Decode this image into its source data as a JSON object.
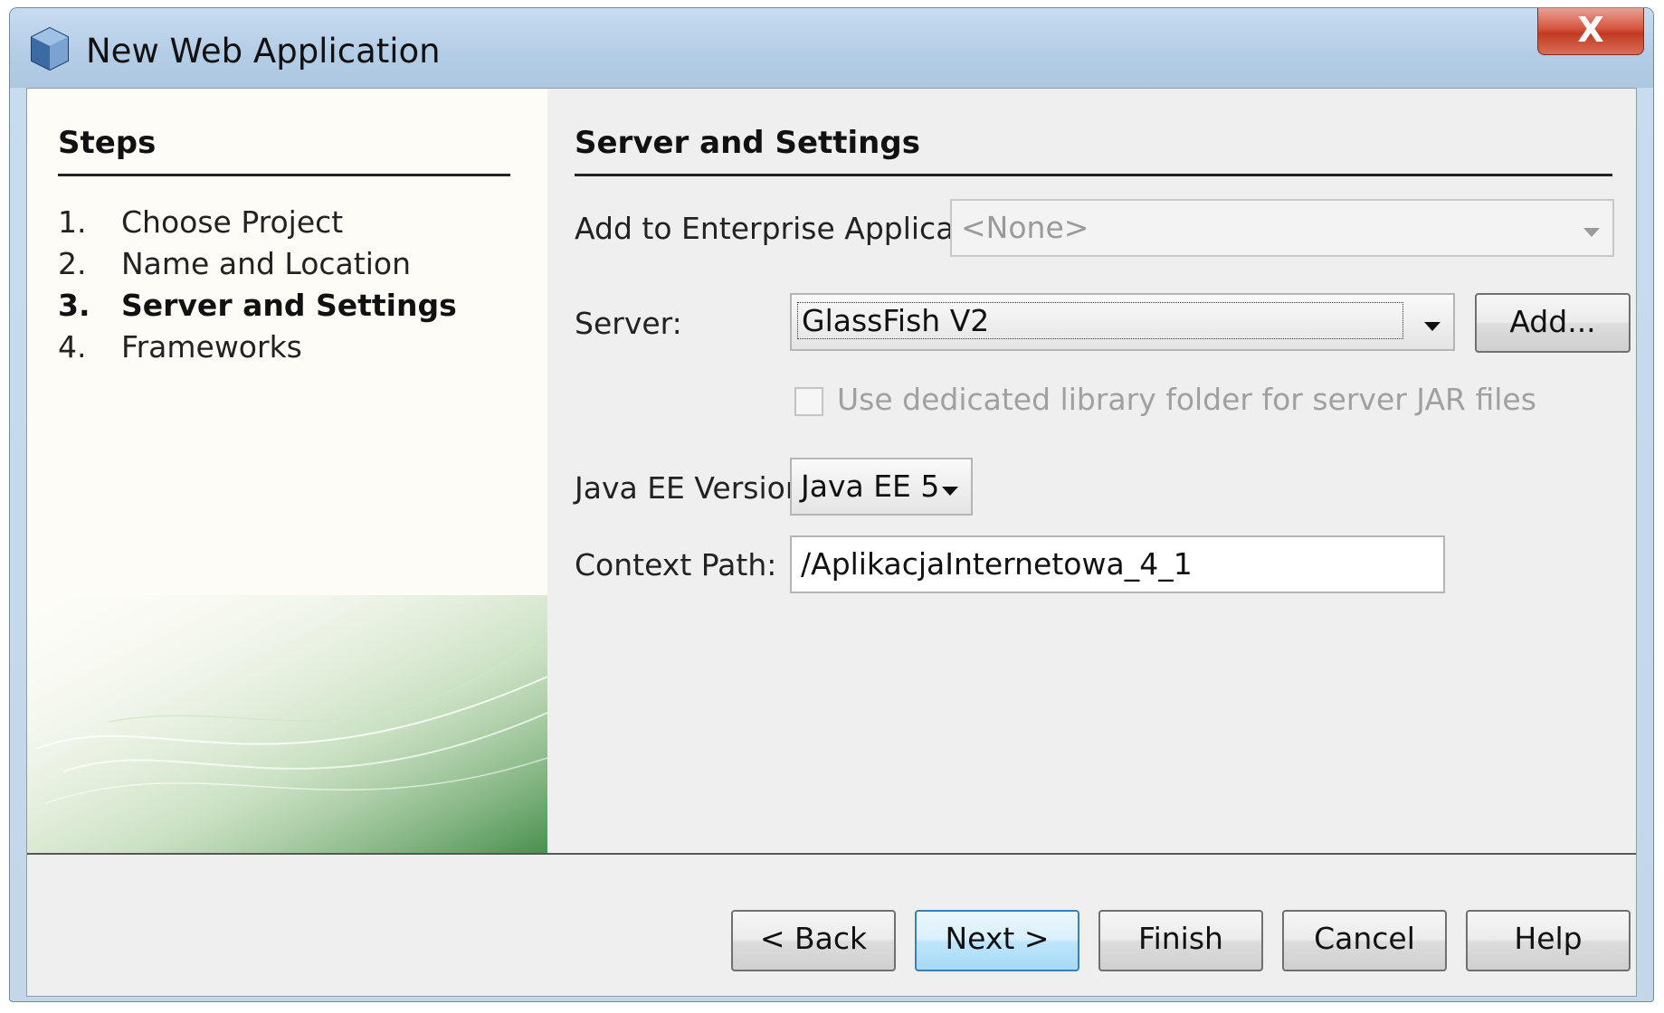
{
  "window": {
    "title": "New Web Application",
    "close_label": "X"
  },
  "steps": {
    "heading": "Steps",
    "items": [
      {
        "num": "1.",
        "label": "Choose Project"
      },
      {
        "num": "2.",
        "label": "Name and Location"
      },
      {
        "num": "3.",
        "label": "Server and Settings",
        "current": true
      },
      {
        "num": "4.",
        "label": "Frameworks"
      }
    ]
  },
  "main": {
    "heading": "Server and Settings",
    "enterprise": {
      "label": "Add to Enterprise Application:",
      "value": "<None>",
      "enabled": false
    },
    "server": {
      "label": "Server:",
      "value": "GlassFish V2",
      "add_label": "Add..."
    },
    "dedicated_library": {
      "label": "Use dedicated library folder for server JAR files",
      "checked": false,
      "enabled": false
    },
    "javaee": {
      "label": "Java EE Version:",
      "value": "Java EE 5"
    },
    "context_path": {
      "label": "Context Path:",
      "value": "/AplikacjaInternetowa_4_1"
    }
  },
  "buttons": {
    "back": "< Back",
    "next": "Next >",
    "finish": "Finish",
    "cancel": "Cancel",
    "help": "Help"
  },
  "colors": {
    "title_bar": "#b4cde6",
    "close_button": "#c23a22",
    "panel_background": "#efefef",
    "steps_background": "#fdfcf7",
    "default_button": "#bee6fd"
  }
}
